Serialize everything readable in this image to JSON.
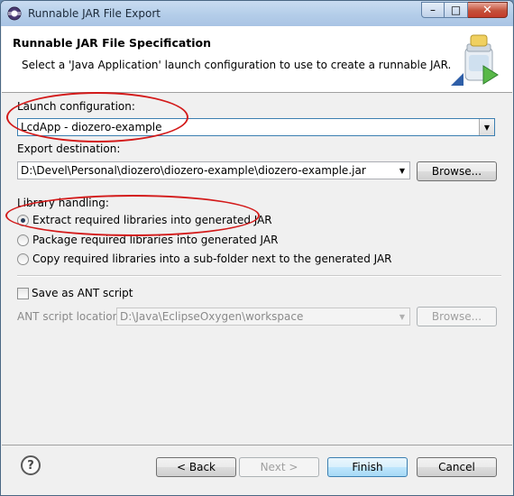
{
  "window": {
    "title": "Runnable JAR File Export",
    "min_label": "–",
    "max_label": "□",
    "close_label": "✕"
  },
  "header": {
    "title": "Runnable JAR File Specification",
    "description": "Select a 'Java Application' launch configuration to use to create a runnable JAR."
  },
  "launch": {
    "label": "Launch configuration:",
    "value": "LcdApp - diozero-example"
  },
  "export": {
    "label": "Export destination:",
    "value": "D:\\Devel\\Personal\\diozero\\diozero-example\\diozero-example.jar",
    "browse_label": "Browse..."
  },
  "library": {
    "label": "Library handling:",
    "options": [
      {
        "label": "Extract required libraries into generated JAR",
        "checked": true
      },
      {
        "label": "Package required libraries into generated JAR",
        "checked": false
      },
      {
        "label": "Copy required libraries into a sub-folder next to the generated JAR",
        "checked": false
      }
    ]
  },
  "ant": {
    "save_label": "Save as ANT script",
    "location_label": "ANT script location:",
    "location_value": "D:\\Java\\EclipseOxygen\\workspace",
    "browse_label": "Browse..."
  },
  "buttons": {
    "help": "?",
    "back": "< Back",
    "next": "Next >",
    "finish": "Finish",
    "cancel": "Cancel"
  },
  "colors": {
    "annotation": "#d31a1a",
    "default_button_border": "#3c7fb1"
  }
}
